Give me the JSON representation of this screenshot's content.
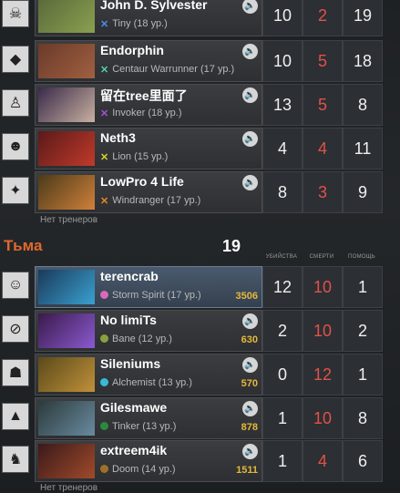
{
  "radiant": {
    "no_coaches": "Нет тренеров",
    "players": [
      {
        "name": "John D. Sylvester",
        "hero": "Tiny (18 ур.)",
        "mark": "x",
        "color": "#4a8ee8",
        "kills": "10",
        "deaths": "2",
        "assists": "19",
        "avatar": "skull-icon",
        "voice": true
      },
      {
        "name": "Endorphin",
        "hero": "Centaur Warrunner (17 ур.)",
        "mark": "x",
        "color": "#4fd0a8",
        "kills": "10",
        "deaths": "5",
        "assists": "18",
        "avatar": "logo-icon",
        "voice": true
      },
      {
        "name": "留在tree里面了",
        "hero": "Invoker (18 ур.)",
        "mark": "x",
        "color": "#a64fd6",
        "kills": "13",
        "deaths": "5",
        "assists": "8",
        "avatar": "figure-icon",
        "voice": true
      },
      {
        "name": "Neth3",
        "hero": "Lion (15 ур.)",
        "mark": "x",
        "color": "#d8d030",
        "kills": "4",
        "deaths": "4",
        "assists": "11",
        "avatar": "portrait-icon",
        "voice": true
      },
      {
        "name": "LowPro 4 Life",
        "hero": "Windranger (17 ур.)",
        "mark": "x",
        "color": "#e08a2a",
        "kills": "8",
        "deaths": "3",
        "assists": "9",
        "avatar": "emblem-icon",
        "voice": true
      }
    ]
  },
  "dire": {
    "team_name": "Тьма",
    "score": "19",
    "headers": {
      "kills": "УБИЙСТВА",
      "deaths": "СМЕРТИ",
      "assists": "ПОМОЩЬ"
    },
    "no_coaches": "Нет тренеров",
    "players": [
      {
        "name": "terencrab",
        "hero": "Storm Spirit (17 ур.)",
        "mark": "c",
        "color": "#d86ab8",
        "networth": "3506",
        "kills": "12",
        "deaths": "10",
        "assists": "1",
        "avatar": "creature-icon",
        "voice": false,
        "highlight": true
      },
      {
        "name": "No limiTs",
        "hero": "Bane (12 ур.)",
        "mark": "c",
        "color": "#8aa040",
        "networth": "630",
        "kills": "2",
        "deaths": "10",
        "assists": "2",
        "avatar": "no-limits-icon",
        "voice": true
      },
      {
        "name": "Sileniums",
        "hero": "Alchemist (13 ур.)",
        "mark": "c",
        "color": "#3ab8d8",
        "networth": "570",
        "kills": "0",
        "deaths": "12",
        "assists": "1",
        "avatar": "mask-icon",
        "voice": true
      },
      {
        "name": "Gilesmawe",
        "hero": "Tinker (13 ур.)",
        "mark": "c",
        "color": "#2a8a3a",
        "networth": "878",
        "kills": "1",
        "deaths": "10",
        "assists": "8",
        "avatar": "scene-icon",
        "voice": true
      },
      {
        "name": "extreem4ik",
        "hero": "Doom (14 ур.)",
        "mark": "c",
        "color": "#a0702a",
        "networth": "1511",
        "kills": "1",
        "deaths": "4",
        "assists": "6",
        "avatar": "character-icon",
        "voice": true
      }
    ]
  },
  "colors": {
    "kills": "#f0f0f0",
    "deaths": "#e0524a",
    "networth": "#e6b83c",
    "dire_team": "#e0692c"
  }
}
